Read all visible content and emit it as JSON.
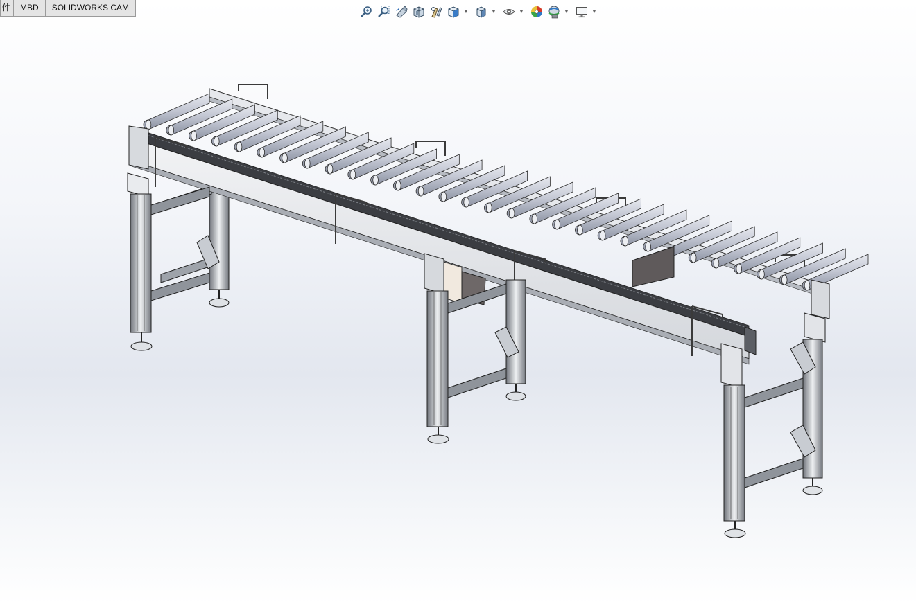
{
  "command_tabs": [
    {
      "label": "件"
    },
    {
      "label": "MBD"
    },
    {
      "label": "SOLIDWORKS CAM"
    }
  ],
  "heads_up_toolbar": [
    {
      "icon": "zoom-to-fit-icon"
    },
    {
      "icon": "zoom-to-area-icon"
    },
    {
      "icon": "previous-view-icon"
    },
    {
      "icon": "section-view-icon"
    },
    {
      "icon": "dynamic-annotation-icon"
    },
    {
      "icon": "view-orientation-icon",
      "dropdown": true
    },
    {
      "icon": "display-style-icon",
      "dropdown": true
    },
    {
      "icon": "hide-show-items-icon",
      "dropdown": true
    },
    {
      "icon": "edit-appearance-icon"
    },
    {
      "icon": "apply-scene-icon",
      "dropdown": true
    },
    {
      "icon": "view-settings-icon",
      "dropdown": true
    }
  ],
  "model": {
    "name": "roller-conveyor",
    "roller_count": 30,
    "support_stands": 3,
    "hand_rails": 4
  },
  "colors": {
    "frame": "#dfe2e6",
    "roller": "#c9ccd6",
    "outline": "#2a2a2a",
    "panel": "#f1e9df"
  }
}
